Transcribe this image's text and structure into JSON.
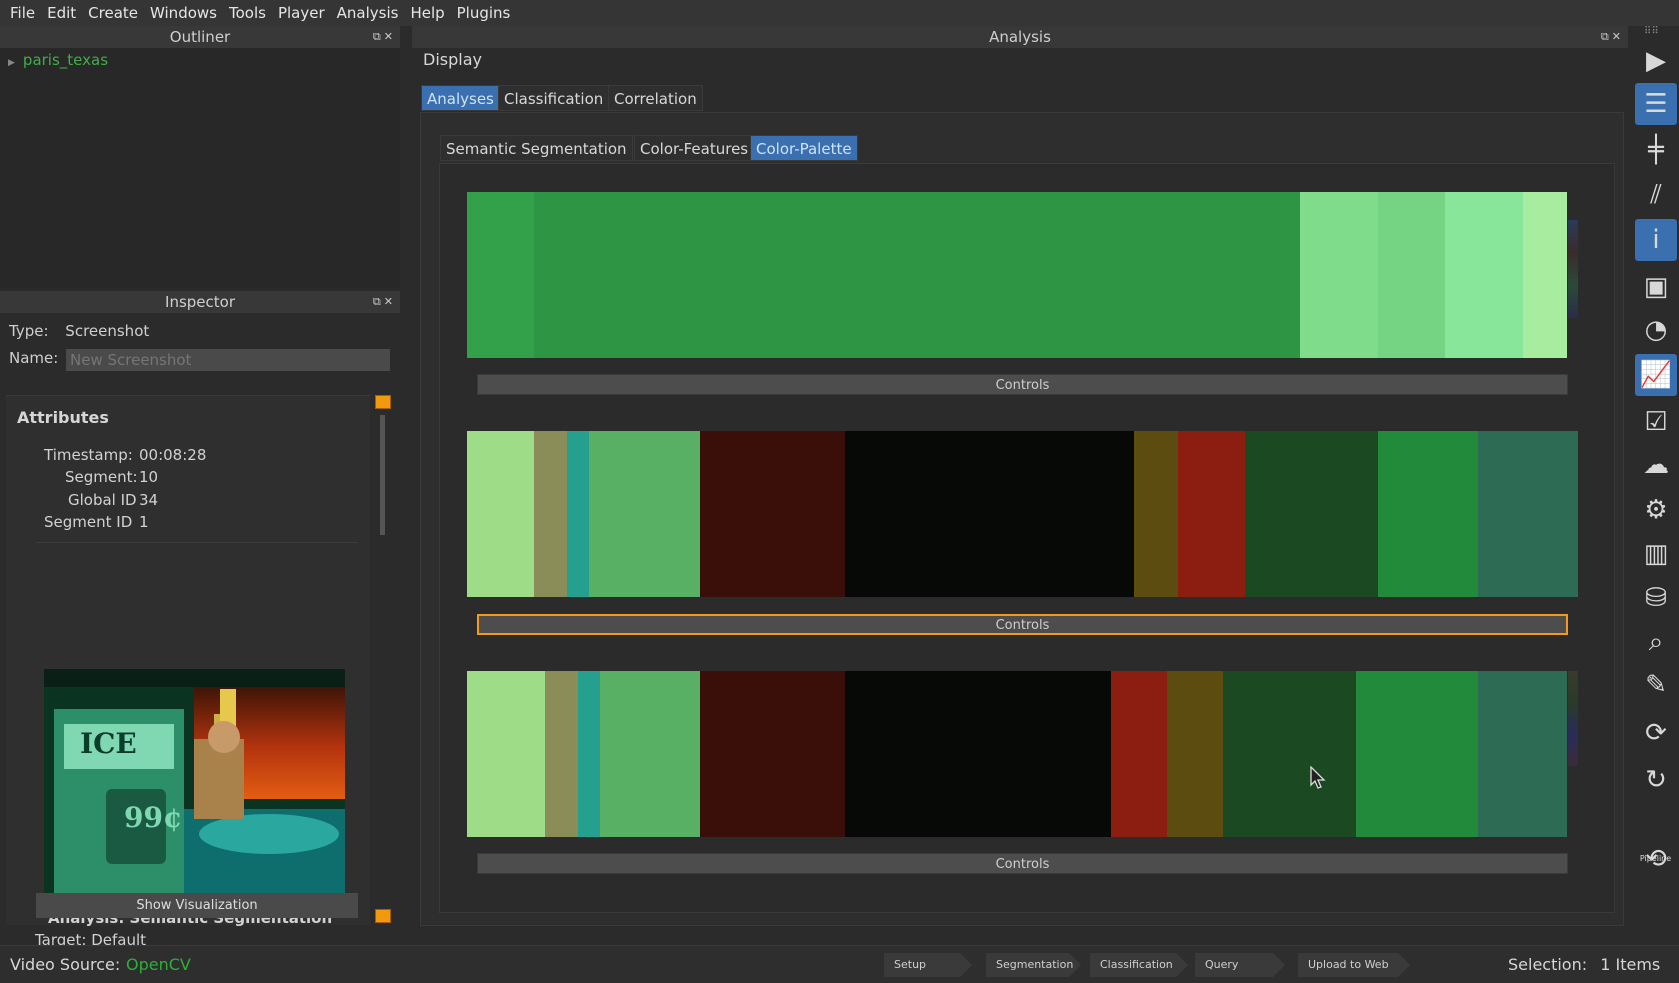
{
  "menu": [
    "File",
    "Edit",
    "Create",
    "Windows",
    "Tools",
    "Player",
    "Analysis",
    "Help",
    "Plugins"
  ],
  "outliner": {
    "title": "Outliner",
    "item": "paris_texas"
  },
  "inspector": {
    "title": "Inspector",
    "type_label": "Type:",
    "type_value": "Screenshot",
    "name_label": "Name:",
    "name_placeholder": "New Screenshot",
    "attributes_title": "Attributes",
    "timestamp_label": "Timestamp:",
    "timestamp": "00:08:28",
    "segment_label": "Segment:",
    "segment": "10",
    "global_id_label": "Global ID",
    "global_id": "34",
    "segment_id_label": "Segment ID",
    "segment_id": "1",
    "analysis_title": "Analysis: Semantic Segmentation",
    "target": "Target: Default",
    "show_visualization": "Show Visualization"
  },
  "analysis": {
    "title": "Analysis",
    "display_label": "Display",
    "tabs": [
      "Analyses",
      "Classification",
      "Correlation"
    ],
    "subtabs": [
      "Semantic Segmentation",
      "Color-Features",
      "Color-Palette"
    ],
    "controls_label": "Controls",
    "palettes": [
      [
        {
          "color": "#33a04a",
          "w": 6
        },
        {
          "color": "#2e9545",
          "w": 69
        },
        {
          "color": "#7fdc8a",
          "w": 7
        },
        {
          "color": "#74d483",
          "w": 6
        },
        {
          "color": "#87e69a",
          "w": 7
        },
        {
          "color": "#a8eca0",
          "w": 4
        }
      ],
      [
        {
          "color": "#9edc87",
          "w": 6
        },
        {
          "color": "#8a8d57",
          "w": 3
        },
        {
          "color": "#25a08e",
          "w": 2
        },
        {
          "color": "#58b065",
          "w": 10
        },
        {
          "color": "#3a0f0a",
          "w": 13
        },
        {
          "color": "#060906",
          "w": 26
        },
        {
          "color": "#5d4c0f",
          "w": 4
        },
        {
          "color": "#8b1e10",
          "w": 6
        },
        {
          "color": "#1b4a22",
          "w": 12
        },
        {
          "color": "#228a3b",
          "w": 9
        },
        {
          "color": "#2d6b54",
          "w": 9
        }
      ],
      [
        {
          "color": "#9edc87",
          "w": 7
        },
        {
          "color": "#8a8d57",
          "w": 3
        },
        {
          "color": "#25a08e",
          "w": 2
        },
        {
          "color": "#58b065",
          "w": 9
        },
        {
          "color": "#3a0f0a",
          "w": 13
        },
        {
          "color": "#060906",
          "w": 24
        },
        {
          "color": "#8b1e10",
          "w": 5
        },
        {
          "color": "#5d4c0f",
          "w": 5
        },
        {
          "color": "#1b4a22",
          "w": 12
        },
        {
          "color": "#228a3b",
          "w": 11
        },
        {
          "color": "#2d6b54",
          "w": 8
        }
      ]
    ]
  },
  "status": {
    "video_source_label": "Video Source:",
    "video_source": "OpenCV",
    "pipeline": [
      "Setup",
      "Segmentation",
      "Classification",
      "Query",
      "Upload to Web"
    ],
    "selection_label": "Selection:",
    "selection_value": "1 Items"
  },
  "toolbar": [
    "play-icon",
    "list-icon",
    "timeline-icon",
    "flow-icon",
    "info-icon",
    "image-icon",
    "graph-icon",
    "chart-icon",
    "checklist-icon",
    "cloud-upload-icon",
    "gear-icon",
    "library-icon",
    "database-icon",
    "search-icon",
    "tag-icon",
    "refresh-image-icon",
    "sync-icon",
    "pipeline-icon"
  ],
  "toolbar_bottom_label": "Pipeline"
}
